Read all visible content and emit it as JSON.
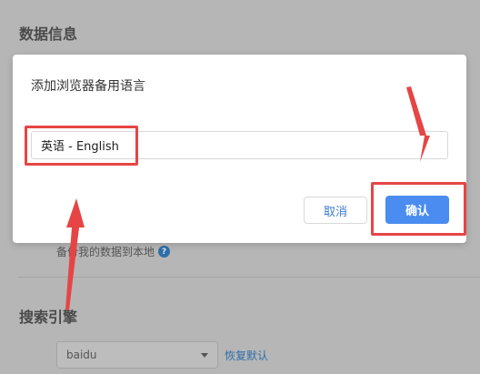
{
  "background": {
    "section_title": "数据信息",
    "checkbox_label": "备份我的数据到本地",
    "help_icon": "?",
    "search_section_title": "搜索引擎",
    "engine_select_value": "baidu",
    "restore_default_link": "恢复默认"
  },
  "dialog": {
    "title": "添加浏览器备用语言",
    "language_input_value": "英语 - English",
    "cancel_label": "取消",
    "confirm_label": "确认"
  },
  "colors": {
    "primary": "#4a8cf0",
    "annotation_red": "#e64545",
    "overlay": "#b6b6b6"
  },
  "icons": {
    "help": "help-icon",
    "dropdown": "chevron-down-icon"
  }
}
